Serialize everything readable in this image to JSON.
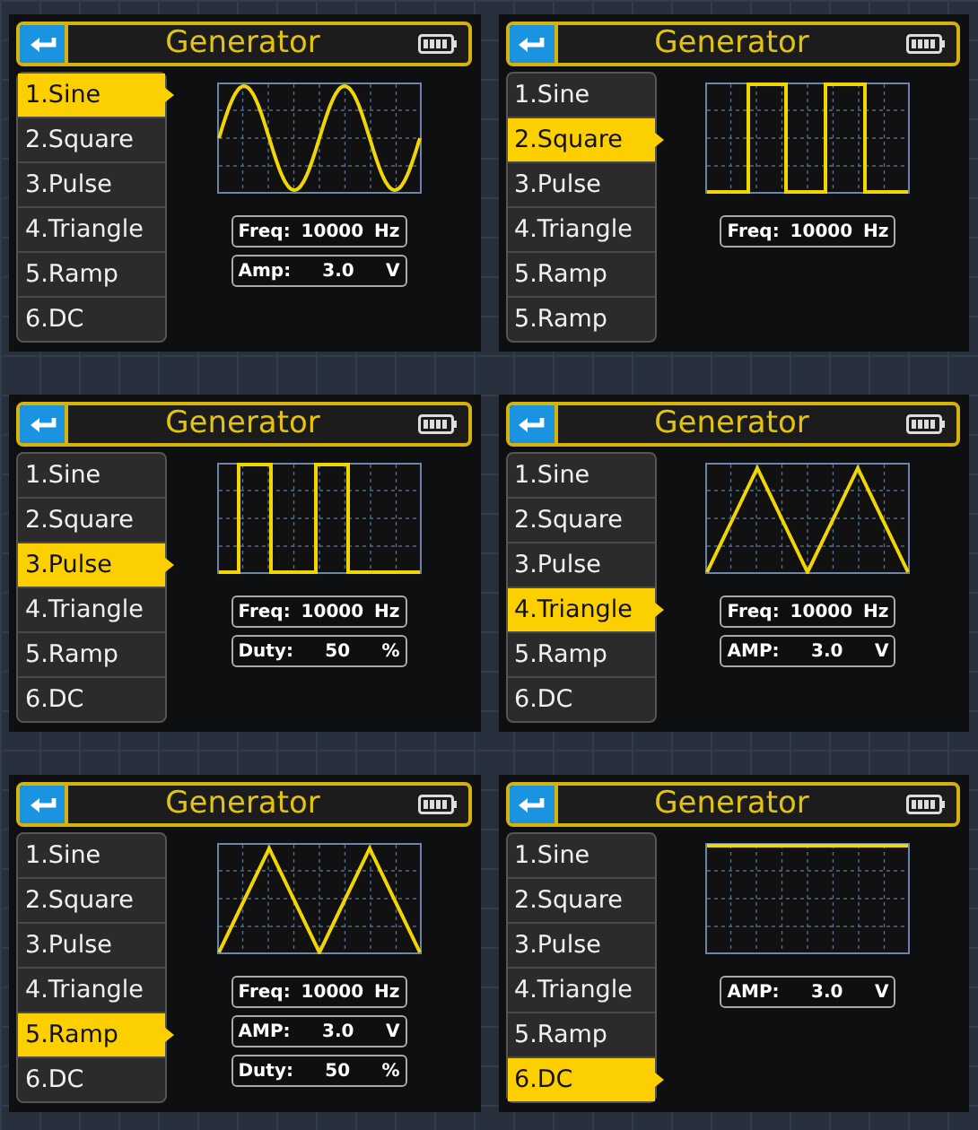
{
  "screens": [
    {
      "title": "Generator",
      "kind": "sine",
      "menu": [
        {
          "label": "1.Sine",
          "selected": true
        },
        {
          "label": "2.Square",
          "selected": false
        },
        {
          "label": "3.Pulse",
          "selected": false
        },
        {
          "label": "4.Triangle",
          "selected": false
        },
        {
          "label": "5.Ramp",
          "selected": false
        },
        {
          "label": "6.DC",
          "selected": false
        }
      ],
      "params": [
        {
          "label": "Freq:",
          "value": "10000",
          "unit": "Hz"
        },
        {
          "label": "Amp:",
          "value": "3.0",
          "unit": "V"
        }
      ]
    },
    {
      "title": "Generator",
      "kind": "square",
      "menu": [
        {
          "label": "1.Sine",
          "selected": false
        },
        {
          "label": "2.Square",
          "selected": true
        },
        {
          "label": "3.Pulse",
          "selected": false
        },
        {
          "label": "4.Triangle",
          "selected": false
        },
        {
          "label": "5.Ramp",
          "selected": false
        },
        {
          "label": "5.Ramp",
          "selected": false
        }
      ],
      "params": [
        {
          "label": "Freq:",
          "value": "10000",
          "unit": "Hz"
        }
      ]
    },
    {
      "title": "Generator",
      "kind": "pulse",
      "menu": [
        {
          "label": "1.Sine",
          "selected": false
        },
        {
          "label": "2.Square",
          "selected": false
        },
        {
          "label": "3.Pulse",
          "selected": true
        },
        {
          "label": "4.Triangle",
          "selected": false
        },
        {
          "label": "5.Ramp",
          "selected": false
        },
        {
          "label": "6.DC",
          "selected": false
        }
      ],
      "params": [
        {
          "label": "Freq:",
          "value": "10000",
          "unit": "Hz"
        },
        {
          "label": "Duty:",
          "value": "50",
          "unit": "%"
        }
      ]
    },
    {
      "title": "Generator",
      "kind": "triangle",
      "menu": [
        {
          "label": "1.Sine",
          "selected": false
        },
        {
          "label": "2.Square",
          "selected": false
        },
        {
          "label": "3.Pulse",
          "selected": false
        },
        {
          "label": "4.Triangle",
          "selected": true
        },
        {
          "label": "5.Ramp",
          "selected": false
        },
        {
          "label": "6.DC",
          "selected": false
        }
      ],
      "params": [
        {
          "label": "Freq:",
          "value": "10000",
          "unit": "Hz"
        },
        {
          "label": "AMP:",
          "value": "3.0",
          "unit": "V"
        }
      ]
    },
    {
      "title": "Generator",
      "kind": "triangle",
      "menu": [
        {
          "label": "1.Sine",
          "selected": false
        },
        {
          "label": "2.Square",
          "selected": false
        },
        {
          "label": "3.Pulse",
          "selected": false
        },
        {
          "label": "4.Triangle",
          "selected": false
        },
        {
          "label": "5.Ramp",
          "selected": true
        },
        {
          "label": "6.DC",
          "selected": false
        }
      ],
      "params": [
        {
          "label": "Freq:",
          "value": "10000",
          "unit": "Hz"
        },
        {
          "label": "AMP:",
          "value": "3.0",
          "unit": "V"
        },
        {
          "label": "Duty:",
          "value": "50",
          "unit": "%"
        }
      ]
    },
    {
      "title": "Generator",
      "kind": "dc",
      "menu": [
        {
          "label": "1.Sine",
          "selected": false
        },
        {
          "label": "2.Square",
          "selected": false
        },
        {
          "label": "3.Pulse",
          "selected": false
        },
        {
          "label": "4.Triangle",
          "selected": false
        },
        {
          "label": "5.Ramp",
          "selected": false
        },
        {
          "label": "6.DC",
          "selected": true
        }
      ],
      "params": [
        {
          "label": "AMP:",
          "value": "3.0",
          "unit": "V"
        }
      ]
    }
  ]
}
